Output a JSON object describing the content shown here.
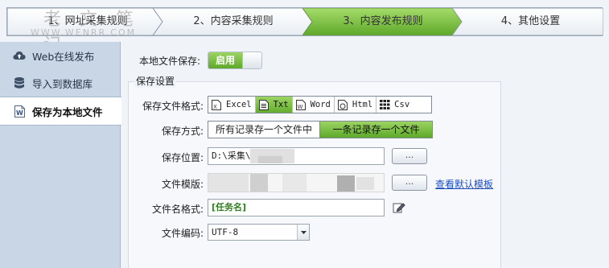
{
  "watermark": {
    "cn": "老 文 笔 记",
    "en": "WWW.WENRR.COM"
  },
  "steps": [
    {
      "label": "1、网址采集规则",
      "active": false
    },
    {
      "label": "2、内容采集规则",
      "active": false
    },
    {
      "label": "3、内容发布规则",
      "active": true
    },
    {
      "label": "4、其他设置",
      "active": false
    }
  ],
  "sidebar": {
    "items": [
      {
        "label": "Web在线发布",
        "icon": "cloud-upload-icon",
        "active": false
      },
      {
        "label": "导入到数据库",
        "icon": "database-icon",
        "active": false
      },
      {
        "label": "保存为本地文件",
        "icon": "word-file-icon",
        "active": true
      }
    ]
  },
  "local_save": {
    "label": "本地文件保存:",
    "toggle_on_label": "启用",
    "enabled": true
  },
  "save_settings": {
    "title": "保存设置",
    "format": {
      "label": "保存文件格式:",
      "options": [
        "Excel",
        "Txt",
        "Word",
        "Html",
        "Csv"
      ],
      "selected": "Txt"
    },
    "mode": {
      "label": "保存方式:",
      "options": [
        "所有记录存一个文件中",
        "一条记录存一个文件"
      ],
      "selected": "一条记录存一个文件"
    },
    "location": {
      "label": "保存位置:",
      "value": "D:\\采集\\",
      "browse_label": "..."
    },
    "template": {
      "label": "文件模版:",
      "browse_label": "...",
      "link": "查看默认模板"
    },
    "filename": {
      "label": "文件名格式:",
      "value": "[任务名]"
    },
    "encoding": {
      "label": "文件编码:",
      "value": "UTF-8"
    }
  },
  "colors": {
    "accent_green": "#6cb33a",
    "sidebar_bg": "#c9d6e6",
    "link": "#1f4fbf"
  }
}
